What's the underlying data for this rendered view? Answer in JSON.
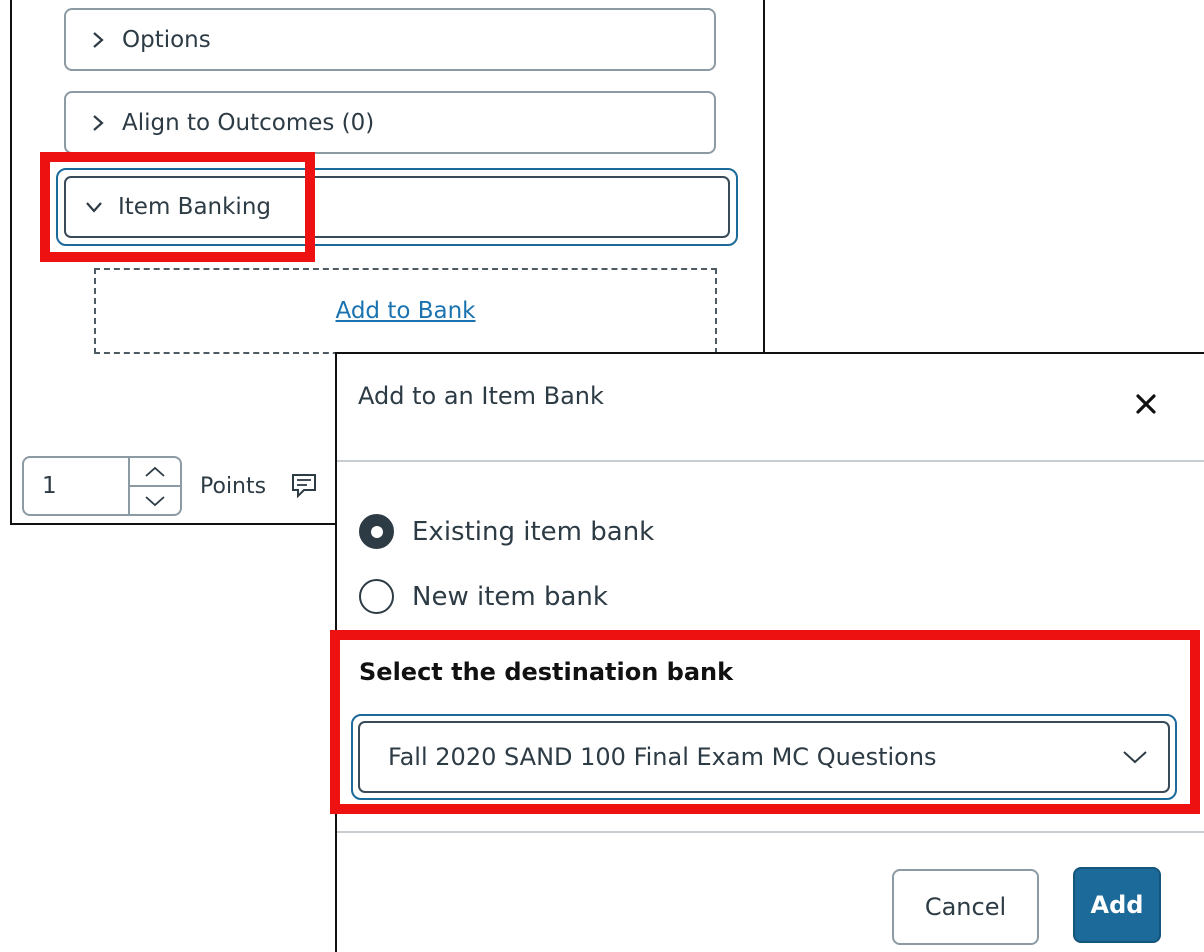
{
  "editor": {
    "options_label": "Options",
    "outcomes_label": "Align to Outcomes (0)",
    "item_banking_label": "Item Banking",
    "add_to_bank_link": "Add to Bank",
    "points_value": "1",
    "points_label": "Points"
  },
  "modal": {
    "title": "Add to an Item Bank",
    "radio_existing": "Existing item bank",
    "radio_new": "New item bank",
    "selected_radio": "existing",
    "select_label": "Select the destination bank",
    "selected_bank": "Fall 2020 SAND 100 Final Exam MC Questions",
    "cancel_label": "Cancel",
    "add_label": "Add"
  },
  "colors": {
    "highlight": "#ee1111",
    "primary": "#1c6a9a",
    "link": "#1a73b0",
    "text": "#2d3b45"
  },
  "icons": {
    "collapsed": "chevron-right-icon",
    "expanded": "chevron-down-icon",
    "close": "close-icon",
    "feedback": "feedback-icon",
    "dropdown": "chevron-down-icon"
  }
}
